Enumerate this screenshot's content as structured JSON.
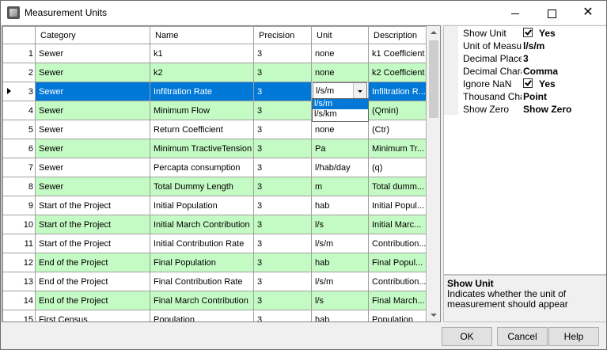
{
  "window": {
    "title": "Measurement Units"
  },
  "grid": {
    "columns": [
      "",
      "Category",
      "Name",
      "Precision",
      "Unit",
      "Description"
    ],
    "rows": [
      {
        "num": "1",
        "category": "Sewer",
        "name": "k1",
        "precision": "3",
        "unit": "none",
        "description": "k1 Coefficient",
        "green": false
      },
      {
        "num": "2",
        "category": "Sewer",
        "name": "k2",
        "precision": "3",
        "unit": "none",
        "description": "k2 Coefficient",
        "green": true
      },
      {
        "num": "3",
        "category": "Sewer",
        "name": "Infiltration Rate",
        "precision": "3",
        "unit": "l/s/m",
        "description": "Infiltration R...",
        "green": false,
        "selected": true
      },
      {
        "num": "4",
        "category": "Sewer",
        "name": "Minimum Flow",
        "precision": "3",
        "unit": "",
        "description": "(Qmin)",
        "green": true
      },
      {
        "num": "5",
        "category": "Sewer",
        "name": "Return Coefficient",
        "precision": "3",
        "unit": "none",
        "description": "(Ctr)",
        "green": false
      },
      {
        "num": "6",
        "category": "Sewer",
        "name": "Minimum TractiveTension",
        "precision": "3",
        "unit": "Pa",
        "description": "Minimum Tr...",
        "green": true
      },
      {
        "num": "7",
        "category": "Sewer",
        "name": "Percapta consumption",
        "precision": "3",
        "unit": "l/hab/day",
        "description": "(q)",
        "green": false
      },
      {
        "num": "8",
        "category": "Sewer",
        "name": "Total Dummy Length",
        "precision": "3",
        "unit": "m",
        "description": "Total dumm...",
        "green": true
      },
      {
        "num": "9",
        "category": "Start of the Project",
        "name": "Initial Population",
        "precision": "3",
        "unit": "hab",
        "description": "Initial Popul...",
        "green": false
      },
      {
        "num": "10",
        "category": "Start of the Project",
        "name": "Initial March Contribution",
        "precision": "3",
        "unit": "l/s",
        "description": "Initial Marc...",
        "green": true
      },
      {
        "num": "11",
        "category": "Start of the Project",
        "name": "Initial Contribution Rate",
        "precision": "3",
        "unit": "l/s/m",
        "description": "Contribution...",
        "green": false
      },
      {
        "num": "12",
        "category": "End of the Project",
        "name": "Final Population",
        "precision": "3",
        "unit": "hab",
        "description": "Final Popul...",
        "green": true
      },
      {
        "num": "13",
        "category": "End of the Project",
        "name": "Final Contribution Rate",
        "precision": "3",
        "unit": "l/s/m",
        "description": "Contribution...",
        "green": false
      },
      {
        "num": "14",
        "category": "End of the Project",
        "name": "Final March Contribution",
        "precision": "3",
        "unit": "l/s",
        "description": "Final March...",
        "green": true
      },
      {
        "num": "15",
        "category": "First Census",
        "name": "Population",
        "precision": "3",
        "unit": "hab",
        "description": "Population",
        "green": false
      }
    ],
    "unit_dropdown": {
      "options": [
        "l/s/m",
        "l/s/km"
      ]
    }
  },
  "properties": {
    "items": [
      {
        "label": "Show Unit",
        "value": "Yes",
        "checkbox": true
      },
      {
        "label": "Unit of Measure",
        "value": "l/s/m",
        "checkbox": false
      },
      {
        "label": "Decimal Places",
        "value": "3",
        "checkbox": false
      },
      {
        "label": "Decimal Character",
        "value": "Comma",
        "checkbox": false
      },
      {
        "label": "Ignore NaN",
        "value": "Yes",
        "checkbox": true
      },
      {
        "label": "Thousand Character",
        "value": "Point",
        "checkbox": false
      },
      {
        "label": "Show Zero",
        "value": "Show Zero",
        "checkbox": false
      }
    ],
    "help_title": "Show Unit",
    "help_desc": "Indicates whether the unit of measurement should appear"
  },
  "buttons": {
    "ok": "OK",
    "cancel": "Cancel",
    "help": "Help"
  },
  "colors": {
    "green_row": "#c4fac4",
    "selection": "#0078d7"
  }
}
